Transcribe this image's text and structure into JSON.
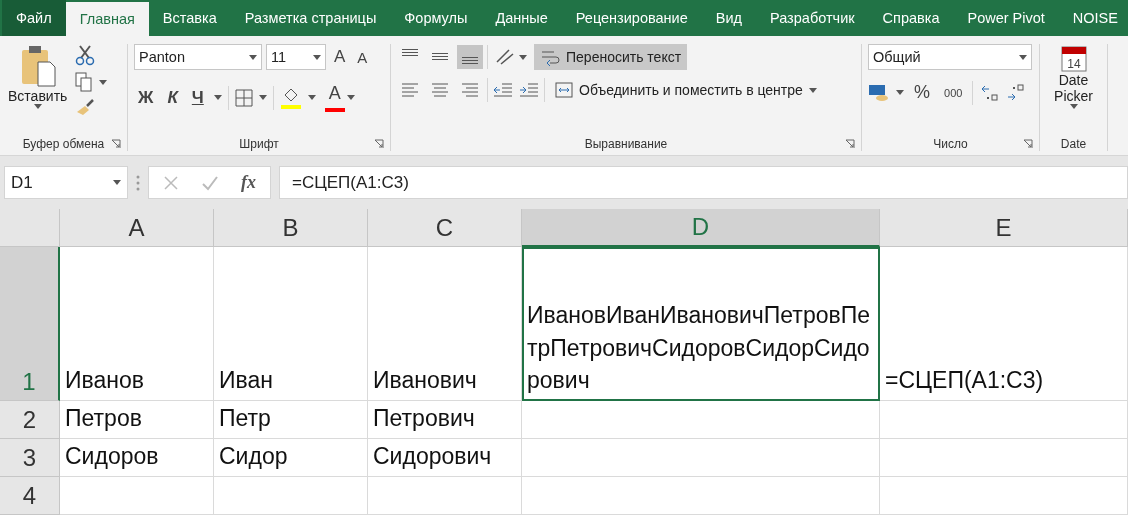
{
  "tabs": [
    {
      "label": "Файл",
      "selected": false
    },
    {
      "label": "Главная",
      "selected": true
    },
    {
      "label": "Вставка",
      "selected": false
    },
    {
      "label": "Разметка страницы",
      "selected": false
    },
    {
      "label": "Формулы",
      "selected": false
    },
    {
      "label": "Данные",
      "selected": false
    },
    {
      "label": "Рецензирование",
      "selected": false
    },
    {
      "label": "Вид",
      "selected": false
    },
    {
      "label": "Разработчик",
      "selected": false
    },
    {
      "label": "Справка",
      "selected": false
    },
    {
      "label": "Power Pivot",
      "selected": false
    },
    {
      "label": "NOISE",
      "selected": false
    }
  ],
  "clipboard": {
    "paste": "Вставить",
    "title": "Буфер обмена"
  },
  "font": {
    "name": "Panton",
    "size": "11",
    "grow": "A",
    "shrink": "A",
    "bold": "Ж",
    "italic": "К",
    "underline": "Ч",
    "font_color_letter": "A",
    "title": "Шрифт"
  },
  "alignment": {
    "vertical": [
      {
        "selected": false
      },
      {
        "selected": false
      },
      {
        "selected": true
      }
    ],
    "wrap": {
      "label": "Переносить текст",
      "on": true
    },
    "merge": {
      "label": "Объединить и поместить в центре"
    },
    "title": "Выравнивание"
  },
  "number": {
    "format": "Общий",
    "percent": "%",
    "thousands": "000",
    "title": "Число"
  },
  "date": {
    "day": "14",
    "button": "Date Picker",
    "title": "Date"
  },
  "formula_bar": {
    "name_box": "D1",
    "fx": "fx",
    "formula": "=СЦЕП(A1:C3)"
  },
  "sheet": {
    "columns": [
      {
        "label": "A",
        "selected": false
      },
      {
        "label": "B",
        "selected": false
      },
      {
        "label": "C",
        "selected": false
      },
      {
        "label": "D",
        "selected": true
      },
      {
        "label": "E",
        "selected": false
      }
    ],
    "rows": [
      {
        "label": "1",
        "selected": true,
        "cells": [
          {
            "text": "Иванов",
            "selected": false
          },
          {
            "text": "Иван",
            "selected": false
          },
          {
            "text": "Иванович",
            "selected": false
          },
          {
            "text": "ИвановИванИвановичПетровПетрПетровичСидоровСидорСидорович",
            "selected": true
          },
          {
            "text": "=СЦЕП(A1:C3)",
            "selected": false
          }
        ]
      },
      {
        "label": "2",
        "selected": false,
        "cells": [
          {
            "text": "Петров",
            "selected": false
          },
          {
            "text": "Петр",
            "selected": false
          },
          {
            "text": "Петрович",
            "selected": false
          },
          {
            "selected": false
          },
          {
            "selected": false
          }
        ]
      },
      {
        "label": "3",
        "selected": false,
        "cells": [
          {
            "text": "Сидоров",
            "selected": false
          },
          {
            "text": "Сидор",
            "selected": false
          },
          {
            "text": "Сидорович",
            "selected": false
          },
          {
            "selected": false
          },
          {
            "selected": false
          }
        ]
      },
      {
        "label": "4",
        "selected": false,
        "cells": [
          {
            "selected": false
          },
          {
            "selected": false
          },
          {
            "selected": false
          },
          {
            "selected": false
          },
          {
            "selected": false
          }
        ]
      }
    ]
  }
}
